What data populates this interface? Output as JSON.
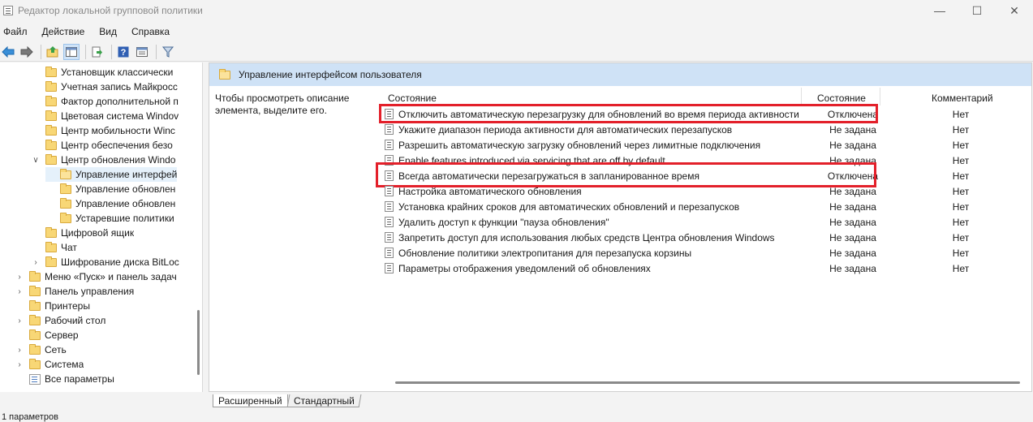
{
  "window": {
    "title": "Редактор локальной групповой политики",
    "icon": "gpedit-icon",
    "controls": [
      "—",
      "☐",
      "✕"
    ]
  },
  "menu": [
    "Файл",
    "Действие",
    "Вид",
    "Справка"
  ],
  "toolbar": {
    "icons": [
      "back-icon",
      "forward-icon",
      "up-folder-icon",
      "show-hide-tree-icon",
      "export-list-icon",
      "help-icon",
      "properties-view-icon",
      "filter-icon"
    ]
  },
  "tree": {
    "items": [
      {
        "label": "Установщик классически",
        "indent": 3,
        "chev": "",
        "type": "folder"
      },
      {
        "label": "Учетная запись Майкросс",
        "indent": 3,
        "chev": "",
        "type": "folder"
      },
      {
        "label": "Фактор дополнительной п",
        "indent": 3,
        "chev": "",
        "type": "folder"
      },
      {
        "label": "Цветовая система Windov",
        "indent": 3,
        "chev": "",
        "type": "folder"
      },
      {
        "label": "Центр мобильности Winc",
        "indent": 3,
        "chev": "",
        "type": "folder"
      },
      {
        "label": "Центр обеспечения безо",
        "indent": 3,
        "chev": "",
        "type": "folder"
      },
      {
        "label": "Центр обновления Windo",
        "indent": 3,
        "chev": "∨",
        "type": "folder"
      },
      {
        "label": "Управление интерфей",
        "indent": 4,
        "chev": "",
        "type": "folder-open",
        "selected": true
      },
      {
        "label": "Управление обновлен",
        "indent": 4,
        "chev": "",
        "type": "folder"
      },
      {
        "label": "Управление обновлен",
        "indent": 4,
        "chev": "",
        "type": "folder"
      },
      {
        "label": "Устаревшие политики",
        "indent": 4,
        "chev": "",
        "type": "folder"
      },
      {
        "label": "Цифровой ящик",
        "indent": 3,
        "chev": "",
        "type": "folder"
      },
      {
        "label": "Чат",
        "indent": 3,
        "chev": "",
        "type": "folder"
      },
      {
        "label": "Шифрование диска BitLoc",
        "indent": 3,
        "chev": "›",
        "type": "folder"
      },
      {
        "label": "Меню «Пуск» и панель задач",
        "indent": 2,
        "chev": "›",
        "type": "folder"
      },
      {
        "label": "Панель управления",
        "indent": 2,
        "chev": "›",
        "type": "folder"
      },
      {
        "label": "Принтеры",
        "indent": 2,
        "chev": "",
        "type": "folder"
      },
      {
        "label": "Рабочий стол",
        "indent": 2,
        "chev": "›",
        "type": "folder"
      },
      {
        "label": "Сервер",
        "indent": 2,
        "chev": "",
        "type": "folder"
      },
      {
        "label": "Сеть",
        "indent": 2,
        "chev": "›",
        "type": "folder"
      },
      {
        "label": "Система",
        "indent": 2,
        "chev": "›",
        "type": "folder"
      },
      {
        "label": "Все параметры",
        "indent": 2,
        "chev": "",
        "type": "settings"
      }
    ]
  },
  "pane": {
    "title": "Управление интерфейсом пользователя",
    "description": "Чтобы просмотреть описание элемента, выделите его.",
    "columns": {
      "name": "Состояние",
      "state": "Состояние",
      "comment": "Комментарий"
    },
    "rows": [
      {
        "name": "Отключить автоматическую перезагрузку для обновлений во время периода активности",
        "state": "Отключена",
        "comment": "Нет",
        "highlighted": true
      },
      {
        "name": "Укажите диапазон периода активности для автоматических перезапусков",
        "state": "Не задана",
        "comment": "Нет"
      },
      {
        "name": "Разрешить автоматическую загрузку обновлений через лимитные подключения",
        "state": "Не задана",
        "comment": "Нет"
      },
      {
        "name": "Enable features introduced via servicing that are off by default",
        "state": "Не задана",
        "comment": "Нет"
      },
      {
        "name": "Всегда автоматически перезагружаться в запланированное время",
        "state": "Отключена",
        "comment": "Нет",
        "highlighted": true
      },
      {
        "name": "Настройка автоматического обновления",
        "state": "Не задана",
        "comment": "Нет"
      },
      {
        "name": "Установка крайних сроков для автоматических обновлений и перезапусков",
        "state": "Не задана",
        "comment": "Нет"
      },
      {
        "name": "Удалить доступ к функции \"пауза обновления\"",
        "state": "Не задана",
        "comment": "Нет"
      },
      {
        "name": "Запретить доступ для использования любых средств Центра обновления Windows",
        "state": "Не задана",
        "comment": "Нет"
      },
      {
        "name": "Обновление политики электропитания для перезапуска корзины",
        "state": "Не задана",
        "comment": "Нет"
      },
      {
        "name": "Параметры отображения уведомлений об обновлениях",
        "state": "Не задана",
        "comment": "Нет"
      }
    ]
  },
  "tabs": [
    "Расширенный",
    "Стандартный"
  ],
  "status": "1 параметров",
  "colors": {
    "highlight": "#e3202a",
    "pane_header": "#cfe2f6",
    "selected": "#e5f1fb"
  }
}
